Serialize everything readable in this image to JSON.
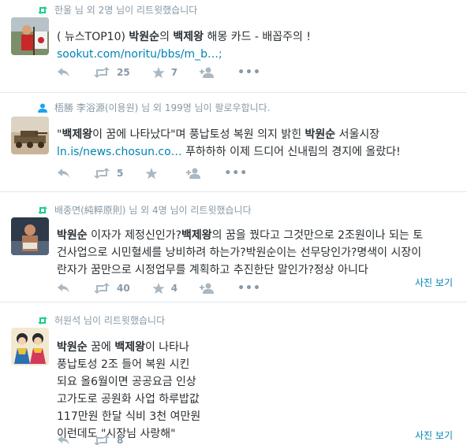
{
  "tweets": [
    {
      "context": "한울 님 외 2명 님이 리트윗했습니다",
      "lines": [
        [
          "( 뉴스TOP10) ",
          "박원순",
          "의 ",
          "백제왕",
          " 해몽 카드 - 배꼽주의 !"
        ]
      ],
      "link": "sookut.com/noritu/bbs/m_b…;",
      "retweets": "25",
      "favorites": "7"
    },
    {
      "context": "梧勝 李浴源(이용원) 님 외 199명 님이 팔로우합니다.",
      "lines": [
        [
          "\"",
          "백제왕",
          "이 꿈에 나타났다\"며 풍납토성 복원 의지 밝힌 ",
          "박원순",
          " 서울시장"
        ]
      ],
      "link": "ln.is/news.chosun.co…",
      "link_suffix": " 푸하하하 이제 드디어 신내림의 경지에 올랐다!",
      "retweets": "5",
      "favorites": ""
    },
    {
      "context": "배종면(純粹原則) 님 외 4명 님이 리트윗했습니다",
      "lines": [
        [
          "",
          "박원순",
          " 이자가 제정신인가?",
          "백제왕",
          "의 꿈을 꿨다고 그것만으로 2조원이나 되는 토"
        ],
        [
          "건사업으로 시민혈세를 낭비하려 하는가?박원순이는 선무당인가?명색이 시장이"
        ],
        [
          "란자가 꿈만으로 시정업무를 계획하고 추진한단 말인가?정상 아니다"
        ]
      ],
      "photo_label": "사진 보기",
      "retweets": "40",
      "favorites": "4"
    },
    {
      "context": "허원석 님이 리트윗했습니다",
      "lines": [
        [
          "",
          "박원순",
          " 꿈에 ",
          "백제왕",
          "이 나타나"
        ],
        [
          "풍납토성 2조 들어 복원 시킨"
        ],
        [
          "되요 올6월이면 공공요금 인상"
        ],
        [
          "고가도로 공원화 사업 하루밥값"
        ],
        [
          "117만원 한달 식비 3천 여만원"
        ],
        [
          "이런데도 \"시장님 사랑해\""
        ]
      ],
      "photo_label": "사진 보기",
      "retweets": "8",
      "favorites": ""
    }
  ]
}
